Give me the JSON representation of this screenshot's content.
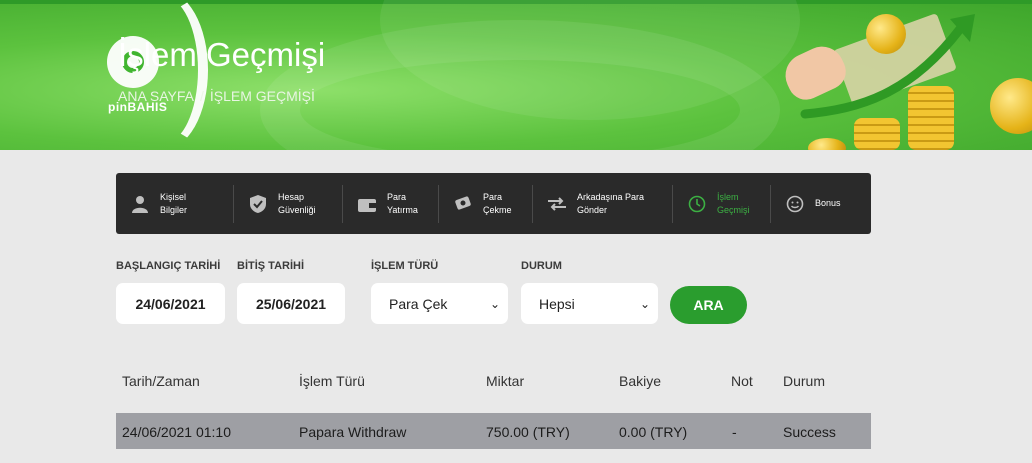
{
  "brand": {
    "logo_text": "pinBAHIS"
  },
  "header": {
    "title": "İşlem Geçmişi",
    "breadcrumb": [
      "ANA SAYFA",
      "İŞLEM GEÇMİŞİ"
    ],
    "breadcrumb_sep": "/"
  },
  "nav": {
    "items": [
      {
        "line1": "Kişisel",
        "line2": "Bilgiler",
        "icon": "user-icon",
        "active": false
      },
      {
        "line1": "Hesap",
        "line2": "Güvenliği",
        "icon": "shield-icon",
        "active": false
      },
      {
        "line1": "Para",
        "line2": "Yatırma",
        "icon": "wallet-icon",
        "active": false
      },
      {
        "line1": "Para",
        "line2": "Çekme",
        "icon": "cash-out-icon",
        "active": false
      },
      {
        "line1": "Arkadaşına Para",
        "line2": "Gönder",
        "icon": "transfer-icon",
        "active": false
      },
      {
        "line1": "İşlem",
        "line2": "Geçmişi",
        "icon": "history-icon",
        "active": true
      },
      {
        "line1": "Bonus",
        "line2": "",
        "icon": "smile-icon",
        "active": false
      }
    ],
    "active_color": "#3cb043"
  },
  "filters": {
    "start_label": "BAŞLANGIÇ TARİHİ",
    "start_value": "24/06/2021",
    "end_label": "BİTİŞ TARİHİ",
    "end_value": "25/06/2021",
    "type_label": "İŞLEM TÜRÜ",
    "type_value": "Para Çek",
    "status_label": "DURUM",
    "status_value": "Hepsi",
    "search_button": "ARA"
  },
  "table": {
    "headers": [
      "Tarih/Zaman",
      "İşlem Türü",
      "Miktar",
      "Bakiye",
      "Not",
      "Durum"
    ],
    "rows": [
      [
        "24/06/2021 01:10",
        "Papara Withdraw",
        "750.00 (TRY)",
        "0.00 (TRY)",
        "-",
        "Success"
      ]
    ]
  },
  "colors": {
    "accent": "#2a9d2e",
    "nav_bg": "#2a2a2a",
    "row_bg": "#9e9fa4"
  }
}
